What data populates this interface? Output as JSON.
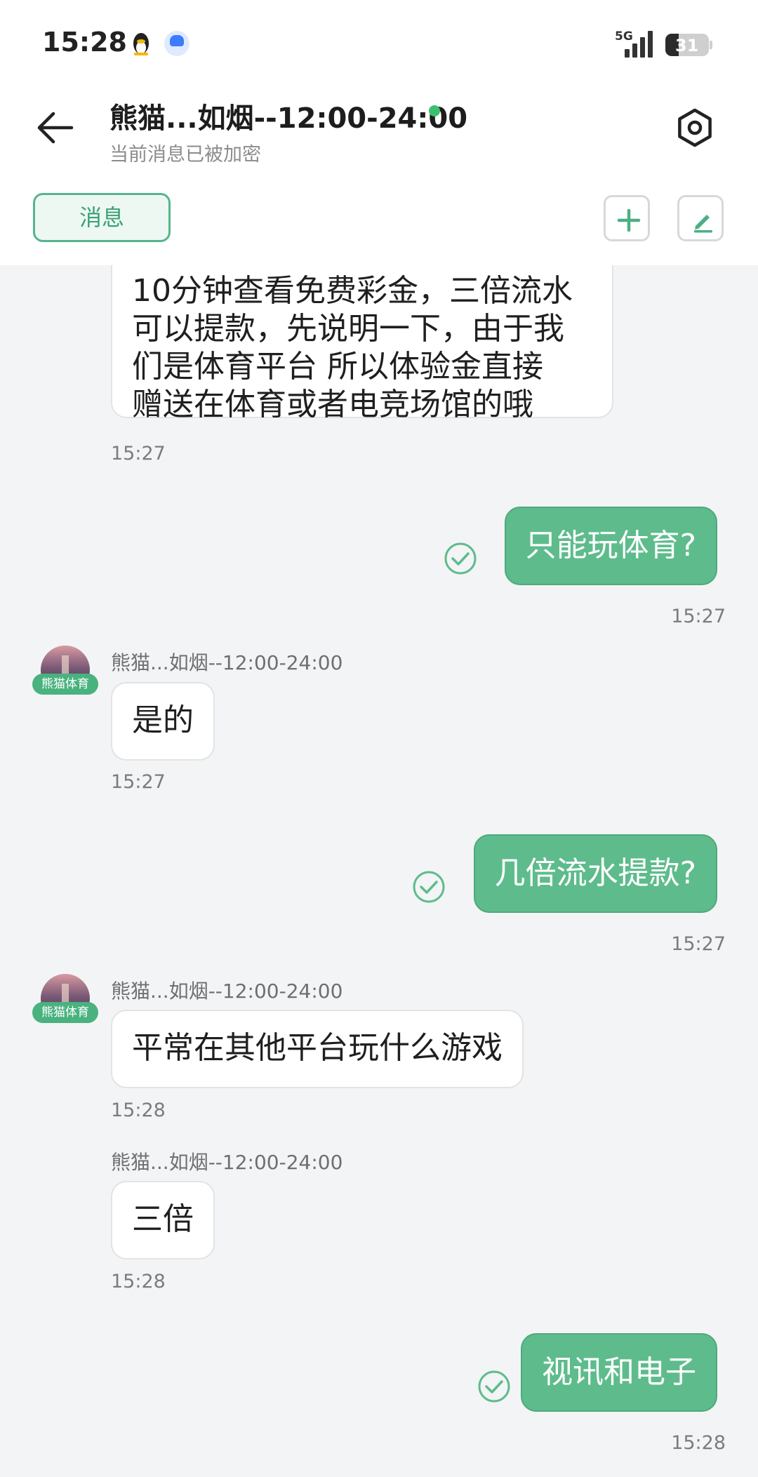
{
  "status_bar": {
    "time": "15:28",
    "network": "5G",
    "battery": "31",
    "battery_level": 0.31,
    "icons": [
      "qq-penguin-icon",
      "baidu-icon",
      "signal-icon",
      "battery-icon"
    ]
  },
  "header": {
    "title": "熊猫...如烟--12:00-24:00",
    "subtitle": "当前消息已被加密",
    "online_color": "#3cc06e",
    "tab_label": "消息",
    "icons": [
      "back-arrow-icon",
      "settings-icon",
      "plus-icon",
      "pencil-icon"
    ]
  },
  "colors": {
    "accent": "#5ebc8c",
    "background": "#f3f4f6"
  },
  "messages": [
    {
      "dir": "in",
      "text_lines": [
        "10分钟查看免费彩金，三倍流水",
        "可以提款，先说明一下，由于我",
        "们是体育平台  所以体验金直接",
        "赠送在体育或者电竞场馆的哦"
      ],
      "time": "15:27"
    },
    {
      "dir": "out",
      "text": "只能玩体育?",
      "time": "15:27"
    },
    {
      "dir": "in",
      "sender": "熊猫...如烟--12:00-24:00",
      "avatar_tag": "熊猫体育",
      "text": "是的",
      "time": "15:27"
    },
    {
      "dir": "out",
      "text": "几倍流水提款?",
      "time": "15:27"
    },
    {
      "dir": "in",
      "sender": "熊猫...如烟--12:00-24:00",
      "avatar_tag": "熊猫体育",
      "text": "平常在其他平台玩什么游戏",
      "time": "15:28"
    },
    {
      "dir": "in",
      "sender": "熊猫...如烟--12:00-24:00",
      "text": "三倍",
      "time": "15:28"
    },
    {
      "dir": "out",
      "text": "视讯和电子",
      "time": "15:28"
    }
  ]
}
